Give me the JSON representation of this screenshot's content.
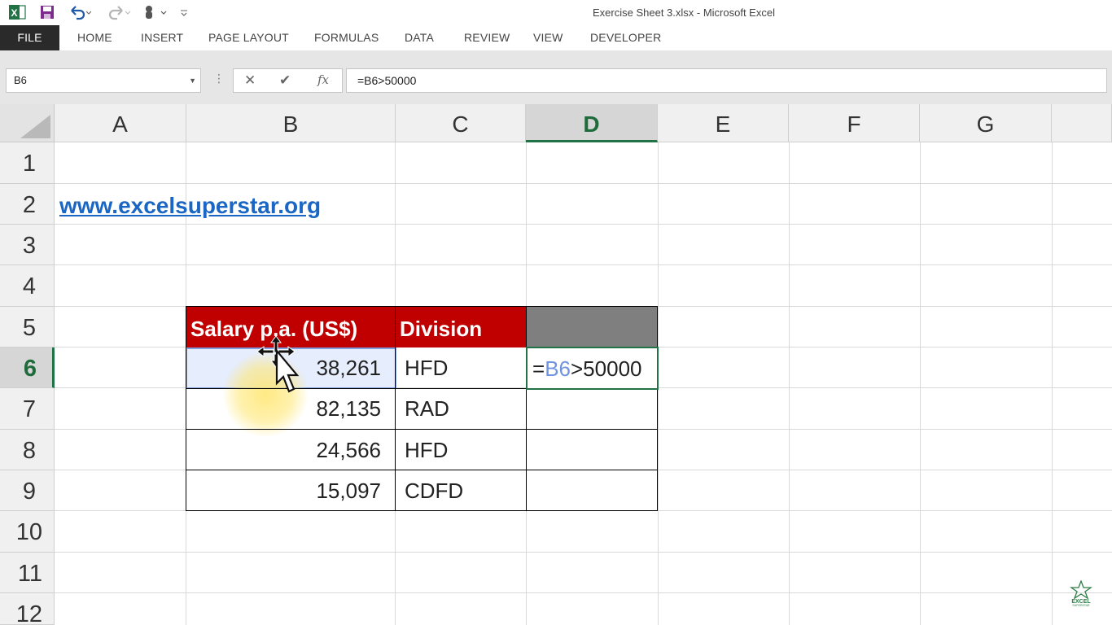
{
  "window": {
    "title": "Exercise Sheet 3.xlsx - Microsoft Excel",
    "quick_access": [
      "excel-app-icon",
      "save-icon",
      "undo-icon",
      "redo-icon",
      "touch-mode-icon",
      "customize-icon"
    ]
  },
  "ribbon": {
    "tabs": [
      "FILE",
      "HOME",
      "INSERT",
      "PAGE LAYOUT",
      "FORMULAS",
      "DATA",
      "REVIEW",
      "VIEW",
      "DEVELOPER"
    ]
  },
  "formula_bar": {
    "name_box": "B6",
    "formula": "=B6>50000"
  },
  "columns": [
    "A",
    "B",
    "C",
    "D",
    "E",
    "F",
    "G"
  ],
  "rows": [
    "1",
    "2",
    "3",
    "4",
    "5",
    "6",
    "7",
    "8",
    "9",
    "10",
    "11",
    "12"
  ],
  "selected": {
    "column": "D",
    "row": "6"
  },
  "cells": {
    "A2": "www.excelsuperstar.org",
    "B5": "Salary p.a. (US$)",
    "C5": "Division",
    "B6": "38,261",
    "C6": "HFD",
    "B7": "82,135",
    "C7": "RAD",
    "B8": "24,566",
    "C8": "HFD",
    "B9": "15,097",
    "C9": "CDFD",
    "D6": {
      "eq": "=",
      "ref": "B6",
      "rest": ">50000"
    }
  },
  "colors": {
    "header_red": "#c00000",
    "header_gray": "#7f7f7f",
    "excel_green": "#217346",
    "link_blue": "#1a66c5",
    "ref_blue": "#6f93e0"
  },
  "watermark": {
    "text": "EXCEL SUPERSTAR"
  }
}
